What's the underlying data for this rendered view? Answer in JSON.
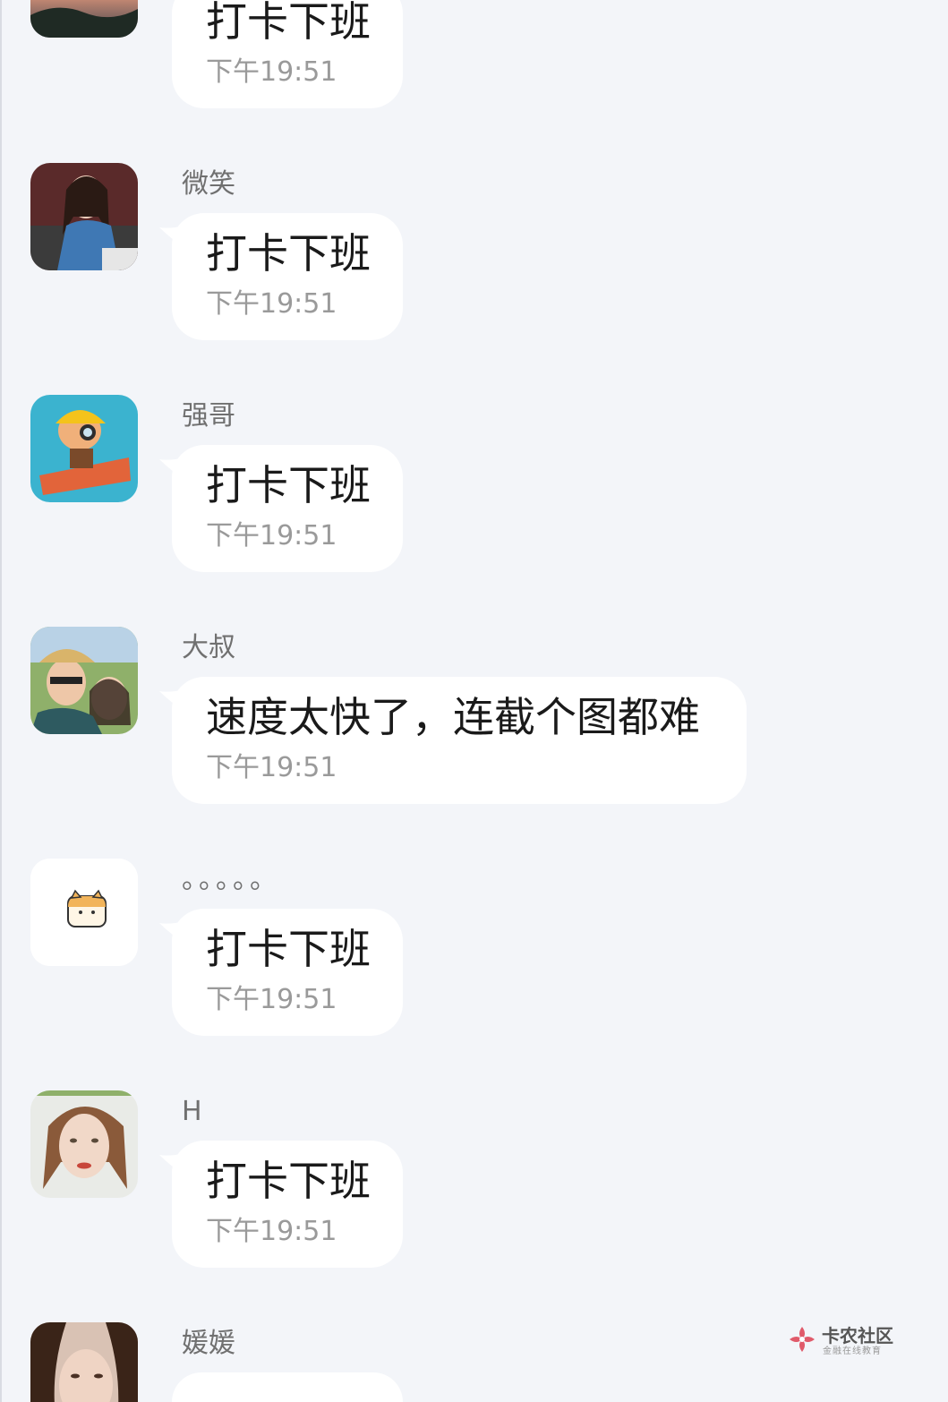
{
  "messages": [
    {
      "sender": "",
      "text": "打卡下班",
      "time": "下午19:51",
      "avatar": "sunset-landscape-avatar"
    },
    {
      "sender": "微笑",
      "text": "打卡下班",
      "time": "下午19:51",
      "avatar": "woman-denim-avatar"
    },
    {
      "sender": "强哥",
      "text": "打卡下班",
      "time": "下午19:51",
      "avatar": "cartoon-pilot-avatar"
    },
    {
      "sender": "大叔",
      "text": "速度太快了，连截个图都难",
      "time": "下午19:51",
      "avatar": "couple-selfie-avatar"
    },
    {
      "sender": "。。。。。",
      "text": "打卡下班",
      "time": "下午19:51",
      "avatar": "cat-sticker-avatar"
    },
    {
      "sender": "H",
      "text": "打卡下班",
      "time": "下午19:51",
      "avatar": "woman-portrait-avatar"
    },
    {
      "sender": "媛媛",
      "text": "",
      "time": "",
      "avatar": "woman-closeup-avatar"
    }
  ],
  "watermark": {
    "title": "卡农社区",
    "subtitle": "金融在线教育"
  },
  "colors": {
    "background": "#f3f5f9",
    "bubble": "#ffffff",
    "sender": "#707070",
    "time": "#9a9a9a",
    "text": "#1a1a1a"
  }
}
